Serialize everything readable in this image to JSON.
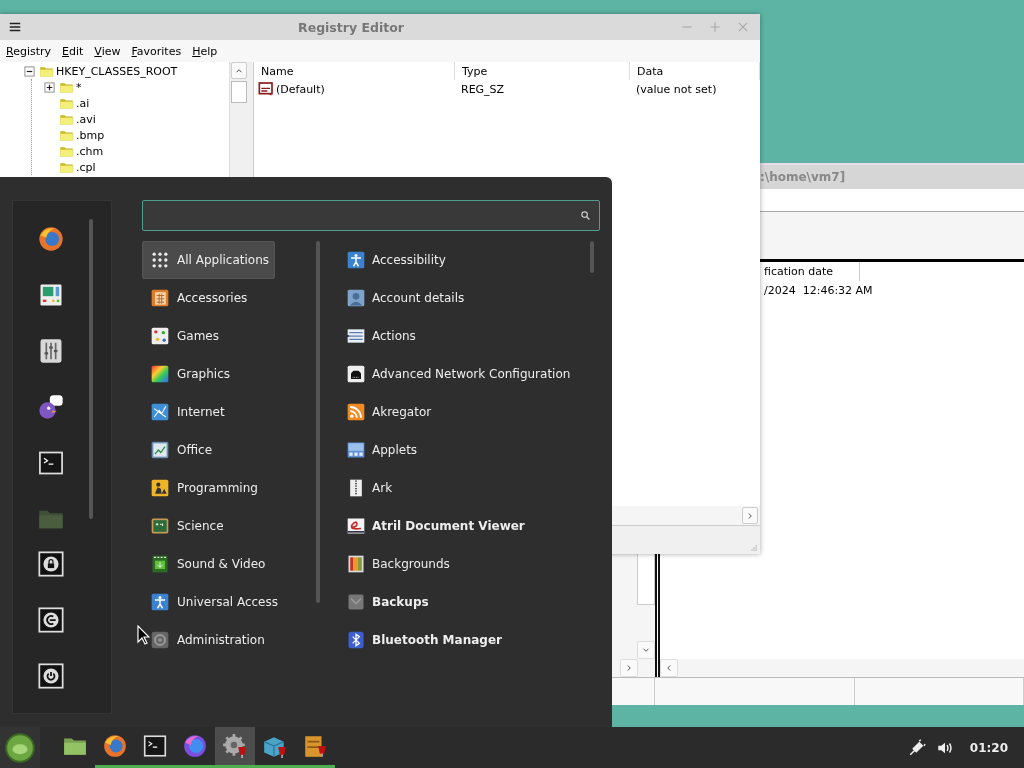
{
  "background_window": {
    "title": ":\\home\\vm7]",
    "columns": [
      "fication date"
    ],
    "rows": [
      [
        "/2024  12:46:32 AM"
      ]
    ]
  },
  "registry_editor": {
    "title": "Registry Editor",
    "menu": [
      "Registry",
      "Edit",
      "View",
      "Favorites",
      "Help"
    ],
    "tree": [
      {
        "label": "HKEY_CLASSES_ROOT",
        "expanded": true,
        "children": [
          {
            "label": "*",
            "expanded": false
          },
          {
            "label": ".ai"
          },
          {
            "label": ".avi"
          },
          {
            "label": ".bmp"
          },
          {
            "label": ".chm"
          },
          {
            "label": ".cpl"
          }
        ]
      }
    ],
    "columns": [
      "Name",
      "Type",
      "Data"
    ],
    "values": [
      {
        "name": "(Default)",
        "type": "REG_SZ",
        "data": "(value not set)"
      }
    ]
  },
  "app_menu": {
    "categories": [
      {
        "label": "All Applications",
        "selected": true
      },
      {
        "label": "Accessories",
        "selected": false
      },
      {
        "label": "Games",
        "selected": false
      },
      {
        "label": "Graphics",
        "selected": false
      },
      {
        "label": "Internet",
        "selected": false
      },
      {
        "label": "Office",
        "selected": false
      },
      {
        "label": "Programming",
        "selected": false
      },
      {
        "label": "Science",
        "selected": false
      },
      {
        "label": "Sound & Video",
        "selected": false
      },
      {
        "label": "Universal Access",
        "selected": false
      },
      {
        "label": "Administration",
        "selected": false
      }
    ],
    "applications": [
      {
        "label": "Accessibility",
        "new": false
      },
      {
        "label": "Account details",
        "new": false
      },
      {
        "label": "Actions",
        "new": false
      },
      {
        "label": "Advanced Network Configuration",
        "new": false
      },
      {
        "label": "Akregator",
        "new": false
      },
      {
        "label": "Applets",
        "new": false
      },
      {
        "label": "Ark",
        "new": false
      },
      {
        "label": "Atril Document Viewer",
        "new": true
      },
      {
        "label": "Backgrounds",
        "new": false
      },
      {
        "label": "Backups",
        "new": true
      },
      {
        "label": "Bluetooth Manager",
        "new": true
      }
    ]
  },
  "taskbar": {
    "launchers": [
      {
        "running": false,
        "active": false
      },
      {
        "running": true,
        "active": false
      },
      {
        "running": true,
        "active": false
      },
      {
        "running": true,
        "active": false
      },
      {
        "running": true,
        "active": true
      },
      {
        "running": true,
        "active": false
      },
      {
        "running": true,
        "active": false
      }
    ],
    "clock": "01:20"
  }
}
